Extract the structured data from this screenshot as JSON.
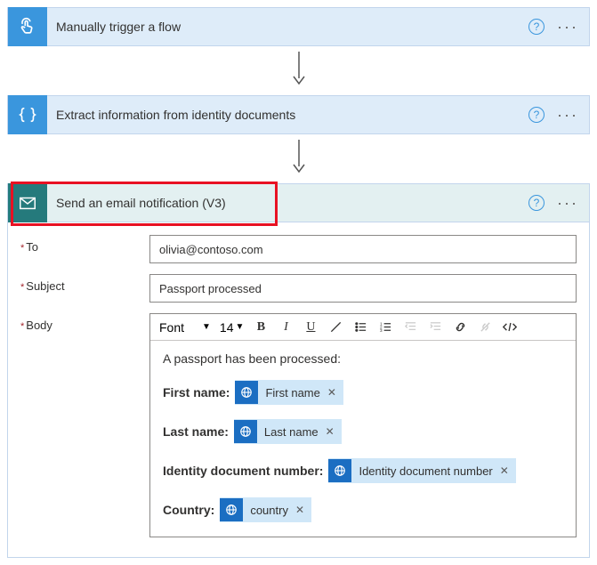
{
  "steps": {
    "trigger": {
      "title": "Manually trigger a flow"
    },
    "extract": {
      "title": "Extract information from identity documents"
    },
    "email": {
      "title": "Send an email notification (V3)"
    }
  },
  "fields": {
    "to": {
      "label": "To",
      "value": "olivia@contoso.com"
    },
    "subject": {
      "label": "Subject",
      "value": "Passport processed"
    },
    "body": {
      "label": "Body"
    }
  },
  "toolbar": {
    "font": "Font",
    "size": "14"
  },
  "body_content": {
    "intro": "A passport has been processed:",
    "lines": {
      "first": {
        "label": "First name:",
        "token": "First name"
      },
      "last": {
        "label": "Last name:",
        "token": "Last name"
      },
      "idnum": {
        "label": "Identity document number:",
        "token": "Identity document number"
      },
      "country": {
        "label": "Country:",
        "token": "country"
      }
    }
  }
}
